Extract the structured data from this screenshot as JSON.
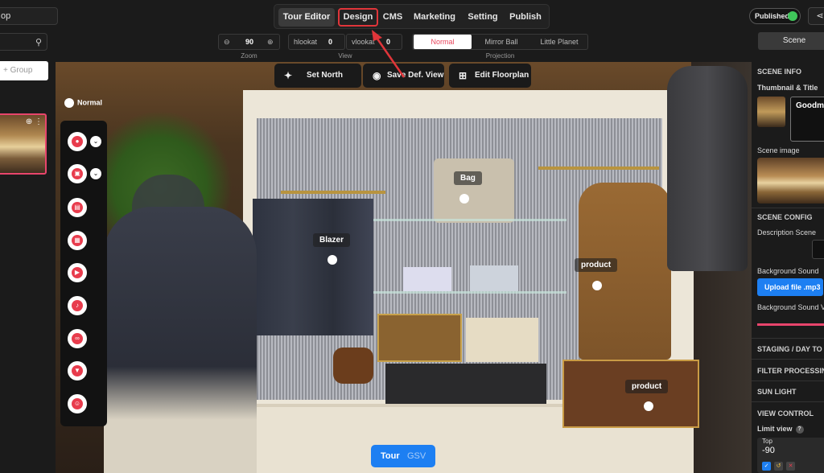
{
  "project": {
    "name": "op"
  },
  "nav": {
    "items": [
      "Tour Editor",
      "Design",
      "CMS",
      "Marketing",
      "Setting",
      "Publish"
    ]
  },
  "status": {
    "published_label": "Published",
    "accent": "#3fc55a"
  },
  "controls": {
    "zoom_value": "90",
    "zoom_minus": "⊖",
    "zoom_plus": "⊕",
    "zoom_label": "Zoom",
    "hlookat_label": "hlookat",
    "hlookat_value": "0",
    "vlookat_label": "vlookat",
    "vlookat_value": "0",
    "view_label": "View",
    "projection_label": "Projection",
    "projection_options": [
      "Normal",
      "Mirror Ball",
      "Little Planet"
    ],
    "projection_selected": "Normal"
  },
  "left_panel": {
    "search_icon": "search-icon",
    "group_button": "+ Group"
  },
  "viewer": {
    "tools": [
      "Set North",
      "Save Def. View",
      "Edit Floorplan"
    ],
    "mode_label": "Normal",
    "hotspots": [
      "Bag",
      "Blazer",
      "product",
      "product"
    ],
    "tour_label": "Tour",
    "gsv_label": "GSV"
  },
  "right_panel": {
    "tab_scene": "Scene",
    "scene_info": "SCENE INFO",
    "thumbnail_title": "Thumbnail & Title",
    "title_value": "Goodma",
    "scene_image": "Scene image",
    "scene_config": "SCENE CONFIG",
    "description_scene": "Description Scene",
    "background_sound": "Background Sound",
    "upload_label": "Upload file .mp3",
    "background_sound_v": "Background Sound V",
    "staging": "STAGING / DAY TO",
    "filter": "FILTER PROCESSIN",
    "sun_light": "SUN LIGHT",
    "view_control": "VIEW CONTROL",
    "limit_view": "Limit view",
    "limit_top_label": "Top",
    "limit_top_value": "-90"
  },
  "colors": {
    "accent_red": "#e8456c",
    "accent_blue": "#1d7ff2",
    "highlight": "#e0353a"
  }
}
